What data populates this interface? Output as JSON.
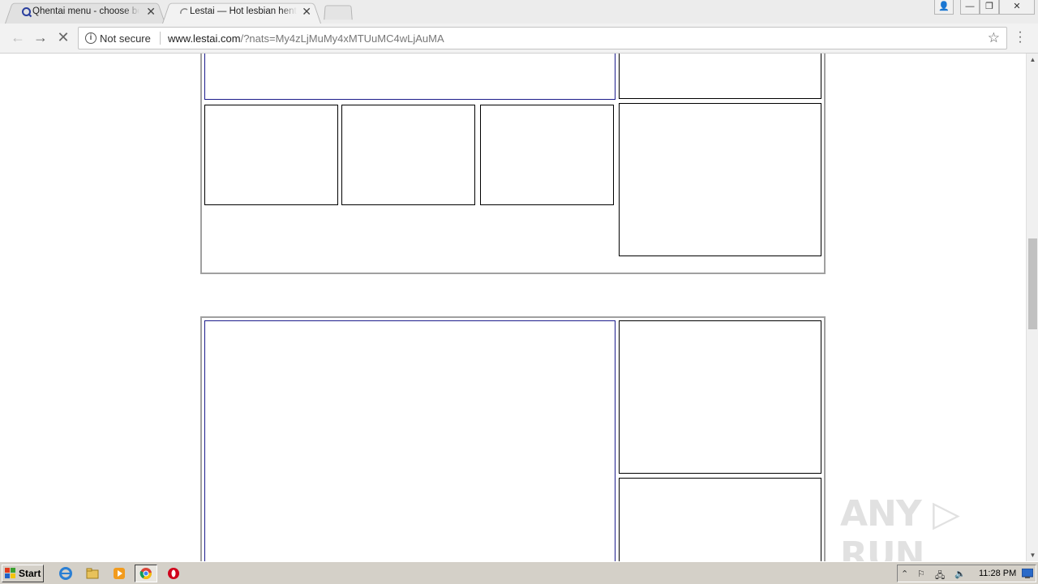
{
  "browser": {
    "tabs": [
      {
        "title": "Qhentai menu - choose betw",
        "close": "✕",
        "active": false
      },
      {
        "title": "Lestai — Hot lesbian hentai",
        "close": "✕",
        "active": true
      }
    ],
    "window_buttons": {
      "user": "👤",
      "minimize": "—",
      "restore": "❐",
      "close": "✕"
    },
    "toolbar": {
      "back": "←",
      "forward": "→",
      "stop": "✕",
      "security_icon": "i",
      "security_label": "Not secure",
      "url_host": "www.lestai.com",
      "url_path": "/?nats=My4zLjMuMy4xMTUuMC4wLjAuMA",
      "bookmark": "☆",
      "menu": "⋮"
    }
  },
  "watermark": "ANY ▷ RUN",
  "taskbar": {
    "start_label": "Start",
    "quick_launch": [
      "ie-icon",
      "explorer-icon",
      "media-player-icon",
      "chrome-icon",
      "opera-icon"
    ],
    "tray_icons": {
      "expand": "⌃",
      "flag": "⚐",
      "network": "🖧",
      "volume": "🔈"
    },
    "clock": "11:28 PM"
  },
  "colors": {
    "accent_blue": "#1c1c8c",
    "block_border": "#a0a0a0",
    "taskbar": "#d4d0c8"
  }
}
